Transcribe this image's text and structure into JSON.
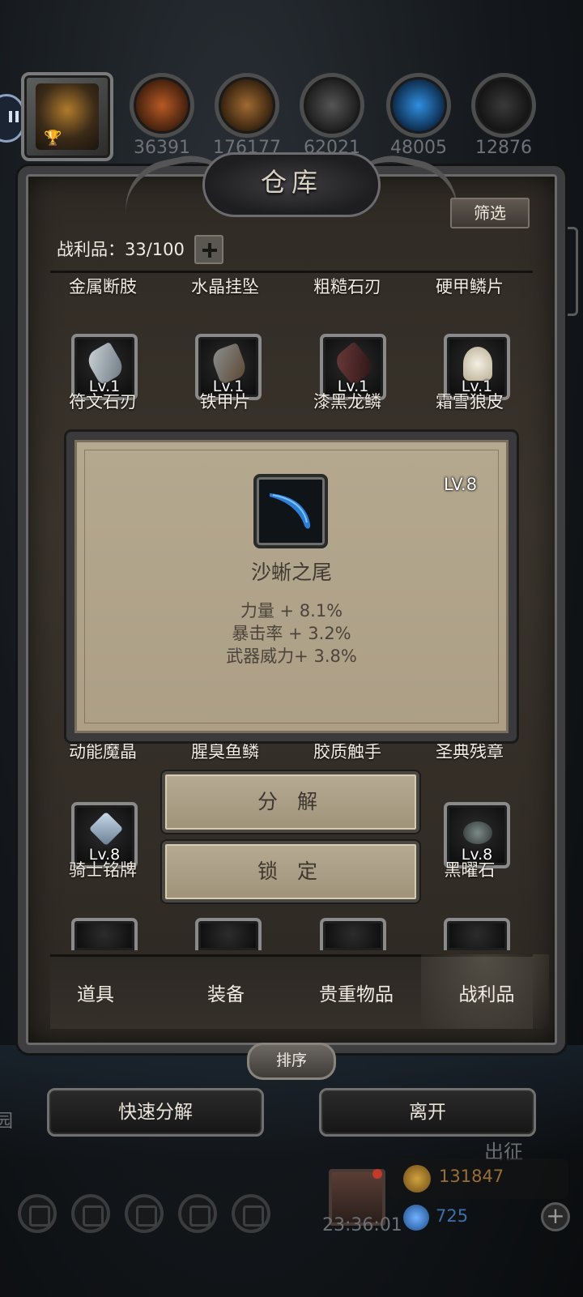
{
  "window": {
    "title": "仓库"
  },
  "resources": [
    {
      "icon": "meat-icon",
      "value": "36391",
      "color": "#b85a25"
    },
    {
      "icon": "wood-icon",
      "value": "176177",
      "color": "#a06a33"
    },
    {
      "icon": "iron-ingot-icon",
      "value": "62021",
      "color": "#555555"
    },
    {
      "icon": "crystal-icon",
      "value": "48005",
      "color": "#2f8fe0"
    },
    {
      "icon": "steel-ingot-icon",
      "value": "12876",
      "color": "#3a3a3a"
    }
  ],
  "toolbar": {
    "filter_label": "筛选"
  },
  "spoils": {
    "label": "战利品：33/100"
  },
  "grid": {
    "row1_names": [
      "金属断肢",
      "水晶挂坠",
      "粗糙石刃",
      "硬甲鳞片"
    ],
    "row2": [
      {
        "name": "符文石刃",
        "level": "Lv.1",
        "icon": "rune-blade-icon"
      },
      {
        "name": "铁甲片",
        "level": "Lv.1",
        "icon": "iron-plate-icon"
      },
      {
        "name": "漆黑龙鳞",
        "level": "Lv.1",
        "icon": "dragon-scale-icon"
      },
      {
        "name": "霜雪狼皮",
        "level": "Lv.1",
        "icon": "wolf-pelt-icon"
      }
    ],
    "row3_names": [
      "动能魔晶",
      "腥臭鱼鳞",
      "胶质触手",
      "圣典残章"
    ],
    "row4": [
      {
        "name": "骑士铭牌",
        "level": "Lv.8",
        "icon": "knight-badge-icon"
      },
      {
        "name": "黑曜石",
        "level": "Lv.8",
        "icon": "obsidian-icon"
      }
    ]
  },
  "popup": {
    "level": "LV.8",
    "name": "沙蜥之尾",
    "icon": "lizard-tail-icon",
    "stats": [
      "力量 + 8.1%",
      "暴击率 + 3.2%",
      "武器威力+ 3.8%"
    ]
  },
  "actions": {
    "decompose": "分 解",
    "lock": "锁 定"
  },
  "tabs": [
    "道具",
    "装备",
    "贵重物品",
    "战利品"
  ],
  "sort_label": "排序",
  "buttons": {
    "quick_decompose": "快速分解",
    "leave": "离开"
  },
  "hud": {
    "expedition": "出征",
    "timer": "23:36:01",
    "gold": "131847",
    "gems": "725",
    "left_text": "园"
  }
}
